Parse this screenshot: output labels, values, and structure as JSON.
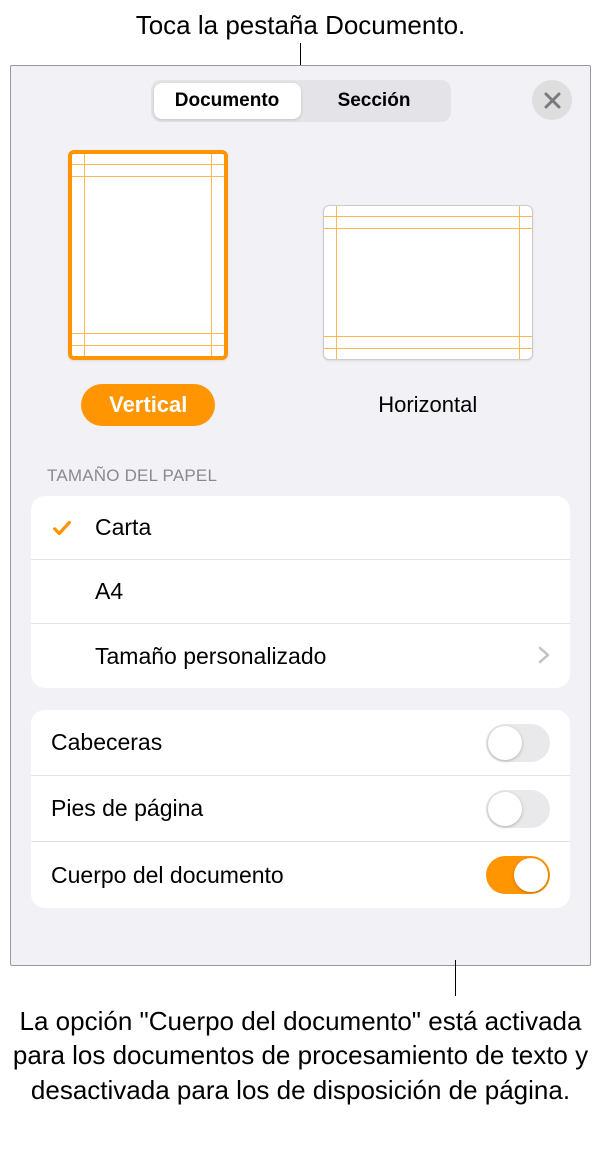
{
  "callouts": {
    "top": "Toca la pestaña Documento.",
    "bottom": "La opción \"Cuerpo del documento\" está activada para los documentos de procesamiento de texto y desactivada para los de disposición de página."
  },
  "tabs": {
    "document": "Documento",
    "section": "Sección"
  },
  "orientation": {
    "vertical": "Vertical",
    "horizontal": "Horizontal"
  },
  "paperSize": {
    "header": "TAMAÑO DEL PAPEL",
    "options": {
      "letter": "Carta",
      "a4": "A4",
      "custom": "Tamaño personalizado"
    }
  },
  "toggles": {
    "headers": "Cabeceras",
    "footers": "Pies de página",
    "body": "Cuerpo del documento"
  }
}
